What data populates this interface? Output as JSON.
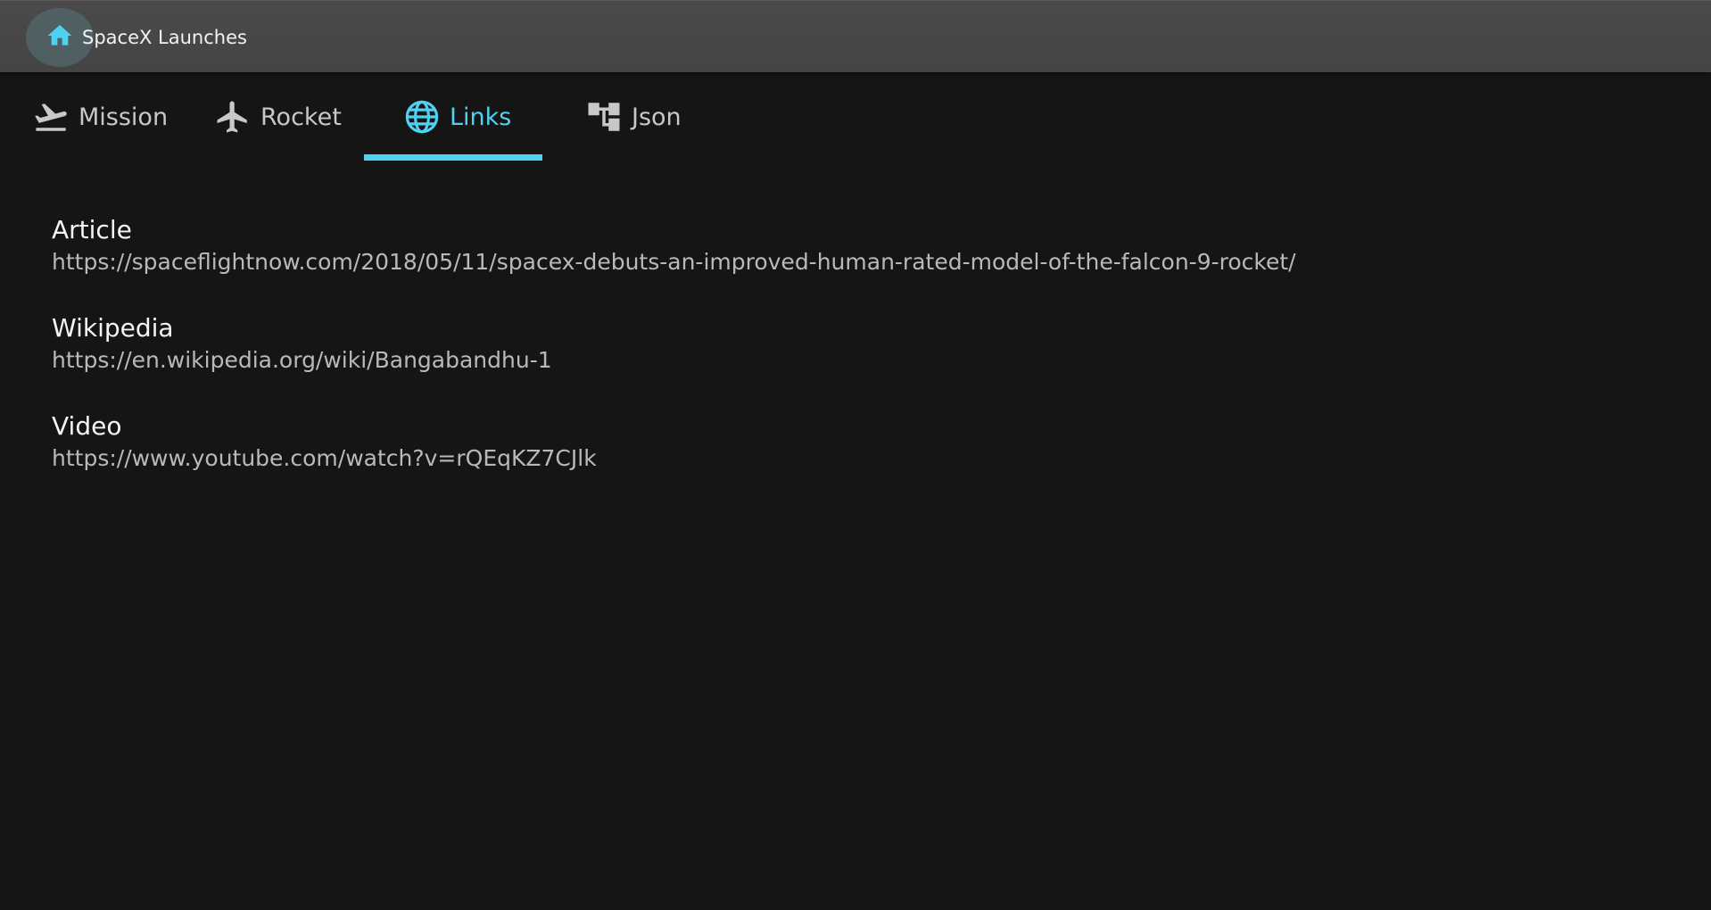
{
  "app_bar": {
    "title": "SpaceX Launches",
    "home_icon": "home-icon",
    "accent_color": "#4fd2f2"
  },
  "tabs": [
    {
      "label": "Mission",
      "icon": "flight-takeoff-icon",
      "active": false
    },
    {
      "label": "Rocket",
      "icon": "airplane-icon",
      "active": false
    },
    {
      "label": "Links",
      "icon": "globe-icon",
      "active": true
    },
    {
      "label": "Json",
      "icon": "tree-structure-icon",
      "active": false
    }
  ],
  "links": [
    {
      "title": "Article",
      "url": "https://spaceflightnow.com/2018/05/11/spacex-debuts-an-improved-human-rated-model-of-the-falcon-9-rocket/"
    },
    {
      "title": "Wikipedia",
      "url": "https://en.wikipedia.org/wiki/Bangabandhu-1"
    },
    {
      "title": "Video",
      "url": "https://www.youtube.com/watch?v=rQEqKZ7CJlk"
    }
  ]
}
